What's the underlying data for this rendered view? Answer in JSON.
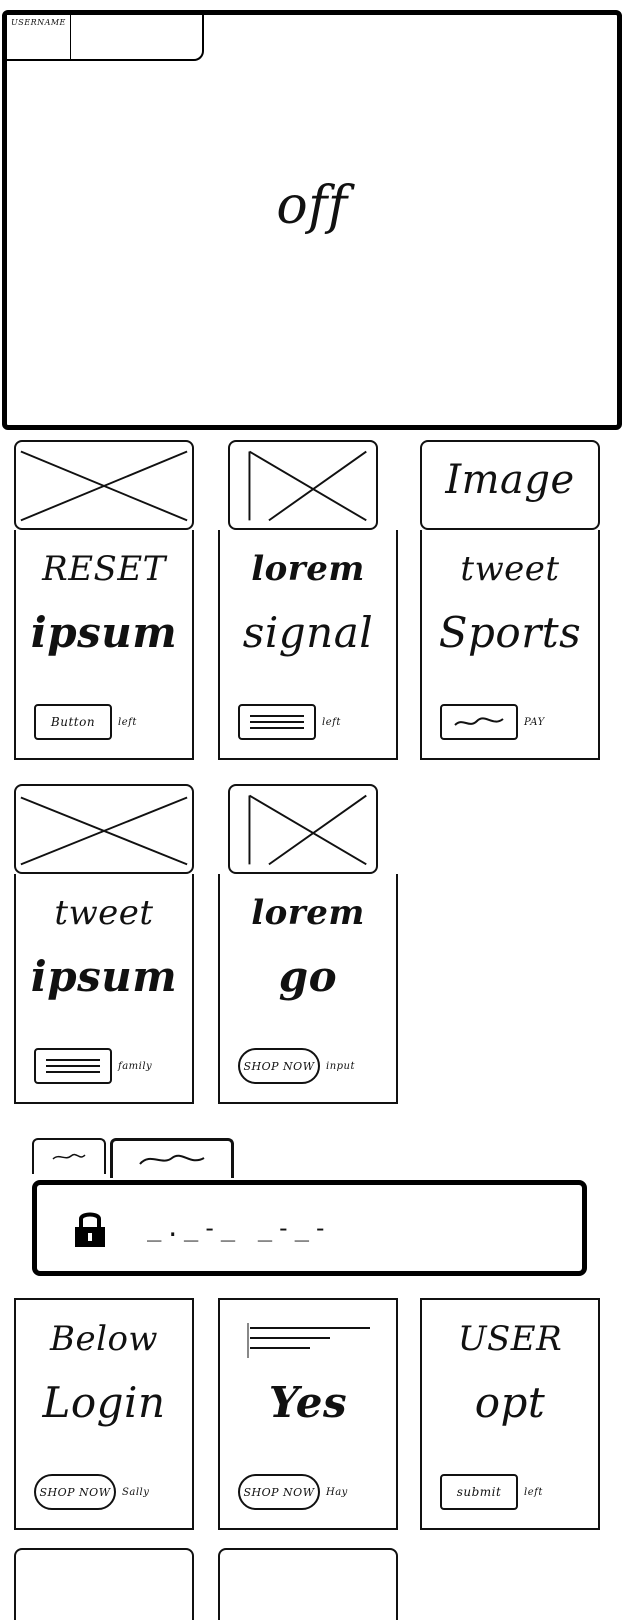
{
  "hero": {
    "username_label": "USERNAME",
    "status": "off"
  },
  "cards": [
    {
      "name": "card-1",
      "line1": "RESET",
      "line2": "ipsum",
      "button": "Button",
      "caption": "left"
    },
    {
      "name": "card-2",
      "line1": "lorem",
      "line2": "signal",
      "button": "",
      "caption": "left"
    },
    {
      "name": "card-3",
      "image_text": "Image",
      "line1": "tweet",
      "line2": "Sports",
      "button": "",
      "caption": "PAY"
    },
    {
      "name": "card-4",
      "line1": "tweet",
      "line2": "ipsum",
      "button": "",
      "caption": "family"
    },
    {
      "name": "card-5",
      "line1": "lorem",
      "line2": "go",
      "button": "SHOP NOW",
      "caption": "input"
    },
    {
      "name": "card-6",
      "line1": "Below",
      "line2": "Login",
      "button": "SHOP NOW",
      "caption": "Sally"
    },
    {
      "name": "card-7",
      "line1": "",
      "line2": "Yes",
      "button": "SHOP NOW",
      "caption": "Hay"
    },
    {
      "name": "card-8",
      "line1": "USER",
      "line2": "opt",
      "button": "submit",
      "caption": "left"
    }
  ],
  "tabs": {
    "tab1": "",
    "tab2": ""
  },
  "search": {
    "placeholder": "_._-_ _-_-"
  }
}
